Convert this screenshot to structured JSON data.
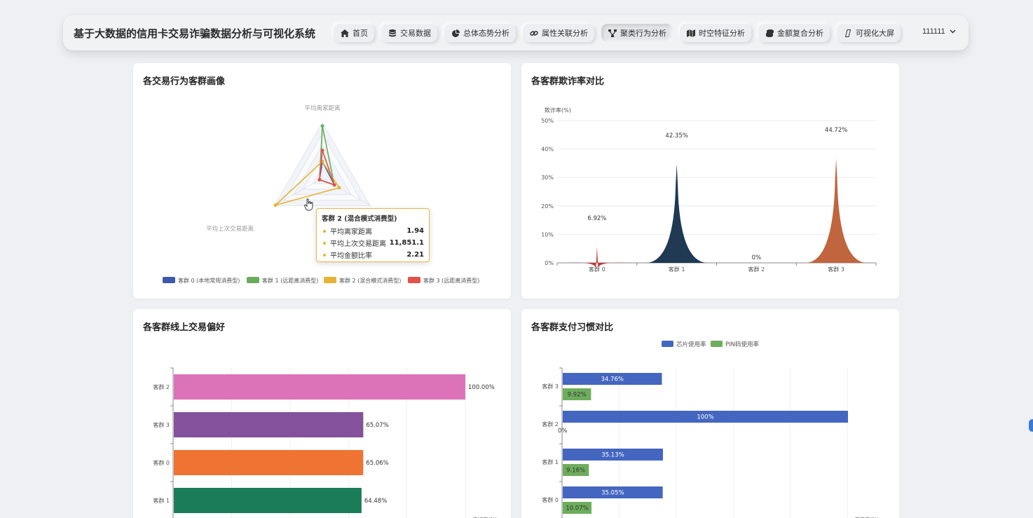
{
  "app": {
    "title": "基于大数据的信用卡交易诈骗数据分析与可视化系统"
  },
  "nav": {
    "items": [
      {
        "label": "首页",
        "icon": "home-icon",
        "active": false
      },
      {
        "label": "交易数据",
        "icon": "database-icon",
        "active": false
      },
      {
        "label": "总体态势分析",
        "icon": "pie-chart-icon",
        "active": false
      },
      {
        "label": "属性关联分析",
        "icon": "link-icon",
        "active": false
      },
      {
        "label": "聚类行为分析",
        "icon": "cluster-icon",
        "active": true
      },
      {
        "label": "时空特征分析",
        "icon": "map-icon",
        "active": false
      },
      {
        "label": "金额复合分析",
        "icon": "coins-icon",
        "active": false
      },
      {
        "label": "可视化大屏",
        "icon": "screen-icon",
        "active": false
      }
    ]
  },
  "user": {
    "name": "111111"
  },
  "colors": {
    "cluster0": "#3d5aa8",
    "cluster1": "#6aac5c",
    "cluster2": "#e6b433",
    "cluster3": "#e0524a",
    "accent": "#e6b433"
  },
  "panels": {
    "radar": {
      "title": "各交易行为客群画像",
      "tooltip": {
        "title": "客群 2 (混合模式消费型)",
        "rows": [
          {
            "label": "平均离家距离",
            "value": "1.94"
          },
          {
            "label": "平均上次交易距离",
            "value": "11,851.1"
          },
          {
            "label": "平均金额比率",
            "value": "2.21"
          }
        ]
      }
    },
    "fraud": {
      "title": "各客群欺诈率对比"
    },
    "online": {
      "title": "各客群线上交易偏好"
    },
    "payment": {
      "title": "各客群支付习惯对比"
    }
  },
  "chart_data": [
    {
      "type": "radar",
      "title": "各交易行为客群画像",
      "indicators": [
        "平均离家距离",
        "平均上次交易距离",
        "平均金额比率"
      ],
      "legend_position": "bottom",
      "series": [
        {
          "name": "客群 0 (本地常规消费型)",
          "values": [
            0.3,
            0.06,
            0.25
          ],
          "color": "#3d5aa8"
        },
        {
          "name": "客群 1 (远距离消费型)",
          "values": [
            0.94,
            0.06,
            0.25
          ],
          "color": "#6aac5c"
        },
        {
          "name": "客群 2 (混合模式消费型)",
          "values": [
            0.3,
            0.98,
            0.35
          ],
          "color": "#e6b433"
        },
        {
          "name": "客群 3 (远距离消费型)",
          "values": [
            0.5,
            0.06,
            0.25
          ],
          "color": "#e0524a"
        }
      ]
    },
    {
      "type": "bar",
      "title": "各客群欺诈率对比",
      "ylabel": "欺诈率(%)",
      "categories": [
        "客群 0",
        "客群 1",
        "客群 2",
        "客群 3"
      ],
      "values": [
        6.92,
        42.35,
        0,
        44.72
      ],
      "labels": [
        "6.92%",
        "42.35%",
        "0%",
        "44.72%"
      ],
      "colors": [
        "#c23a32",
        "#1f3a52",
        "#888888",
        "#c0653e"
      ],
      "ylim": [
        0,
        50
      ],
      "yticks": [
        "0%",
        "10%",
        "20%",
        "30%",
        "40%",
        "50%"
      ],
      "grid": true
    },
    {
      "type": "bar",
      "orientation": "horizontal",
      "title": "各客群线上交易偏好",
      "categories": [
        "客群 2",
        "客群 3",
        "客群 0",
        "客群 1"
      ],
      "values": [
        100.0,
        65.07,
        65.06,
        64.48
      ],
      "labels": [
        "100.00%",
        "65.07%",
        "65.06%",
        "64.48%"
      ],
      "colors": [
        "#dc72b8",
        "#84519c",
        "#ef7434",
        "#1b7c5a"
      ],
      "xlim": [
        0,
        100
      ],
      "xlabel": "偏好率(%)"
    },
    {
      "type": "bar",
      "orientation": "horizontal",
      "title": "各客群支付习惯对比",
      "categories": [
        "客群 3",
        "客群 2",
        "客群 1",
        "客群 0"
      ],
      "legend_position": "top",
      "xlabel": "使用率(%)",
      "xlim": [
        0,
        100
      ],
      "series": [
        {
          "name": "芯片使用率",
          "values": [
            34.76,
            100,
            35.13,
            35.05
          ],
          "labels": [
            "34.76%",
            "100%",
            "35.13%",
            "35.05%"
          ],
          "color": "#4466c0"
        },
        {
          "name": "PIN码使用率",
          "values": [
            9.92,
            0,
            9.16,
            10.07
          ],
          "labels": [
            "9.92%",
            "0%",
            "9.16%",
            "10.07%"
          ],
          "color": "#6dad5c"
        }
      ]
    }
  ]
}
